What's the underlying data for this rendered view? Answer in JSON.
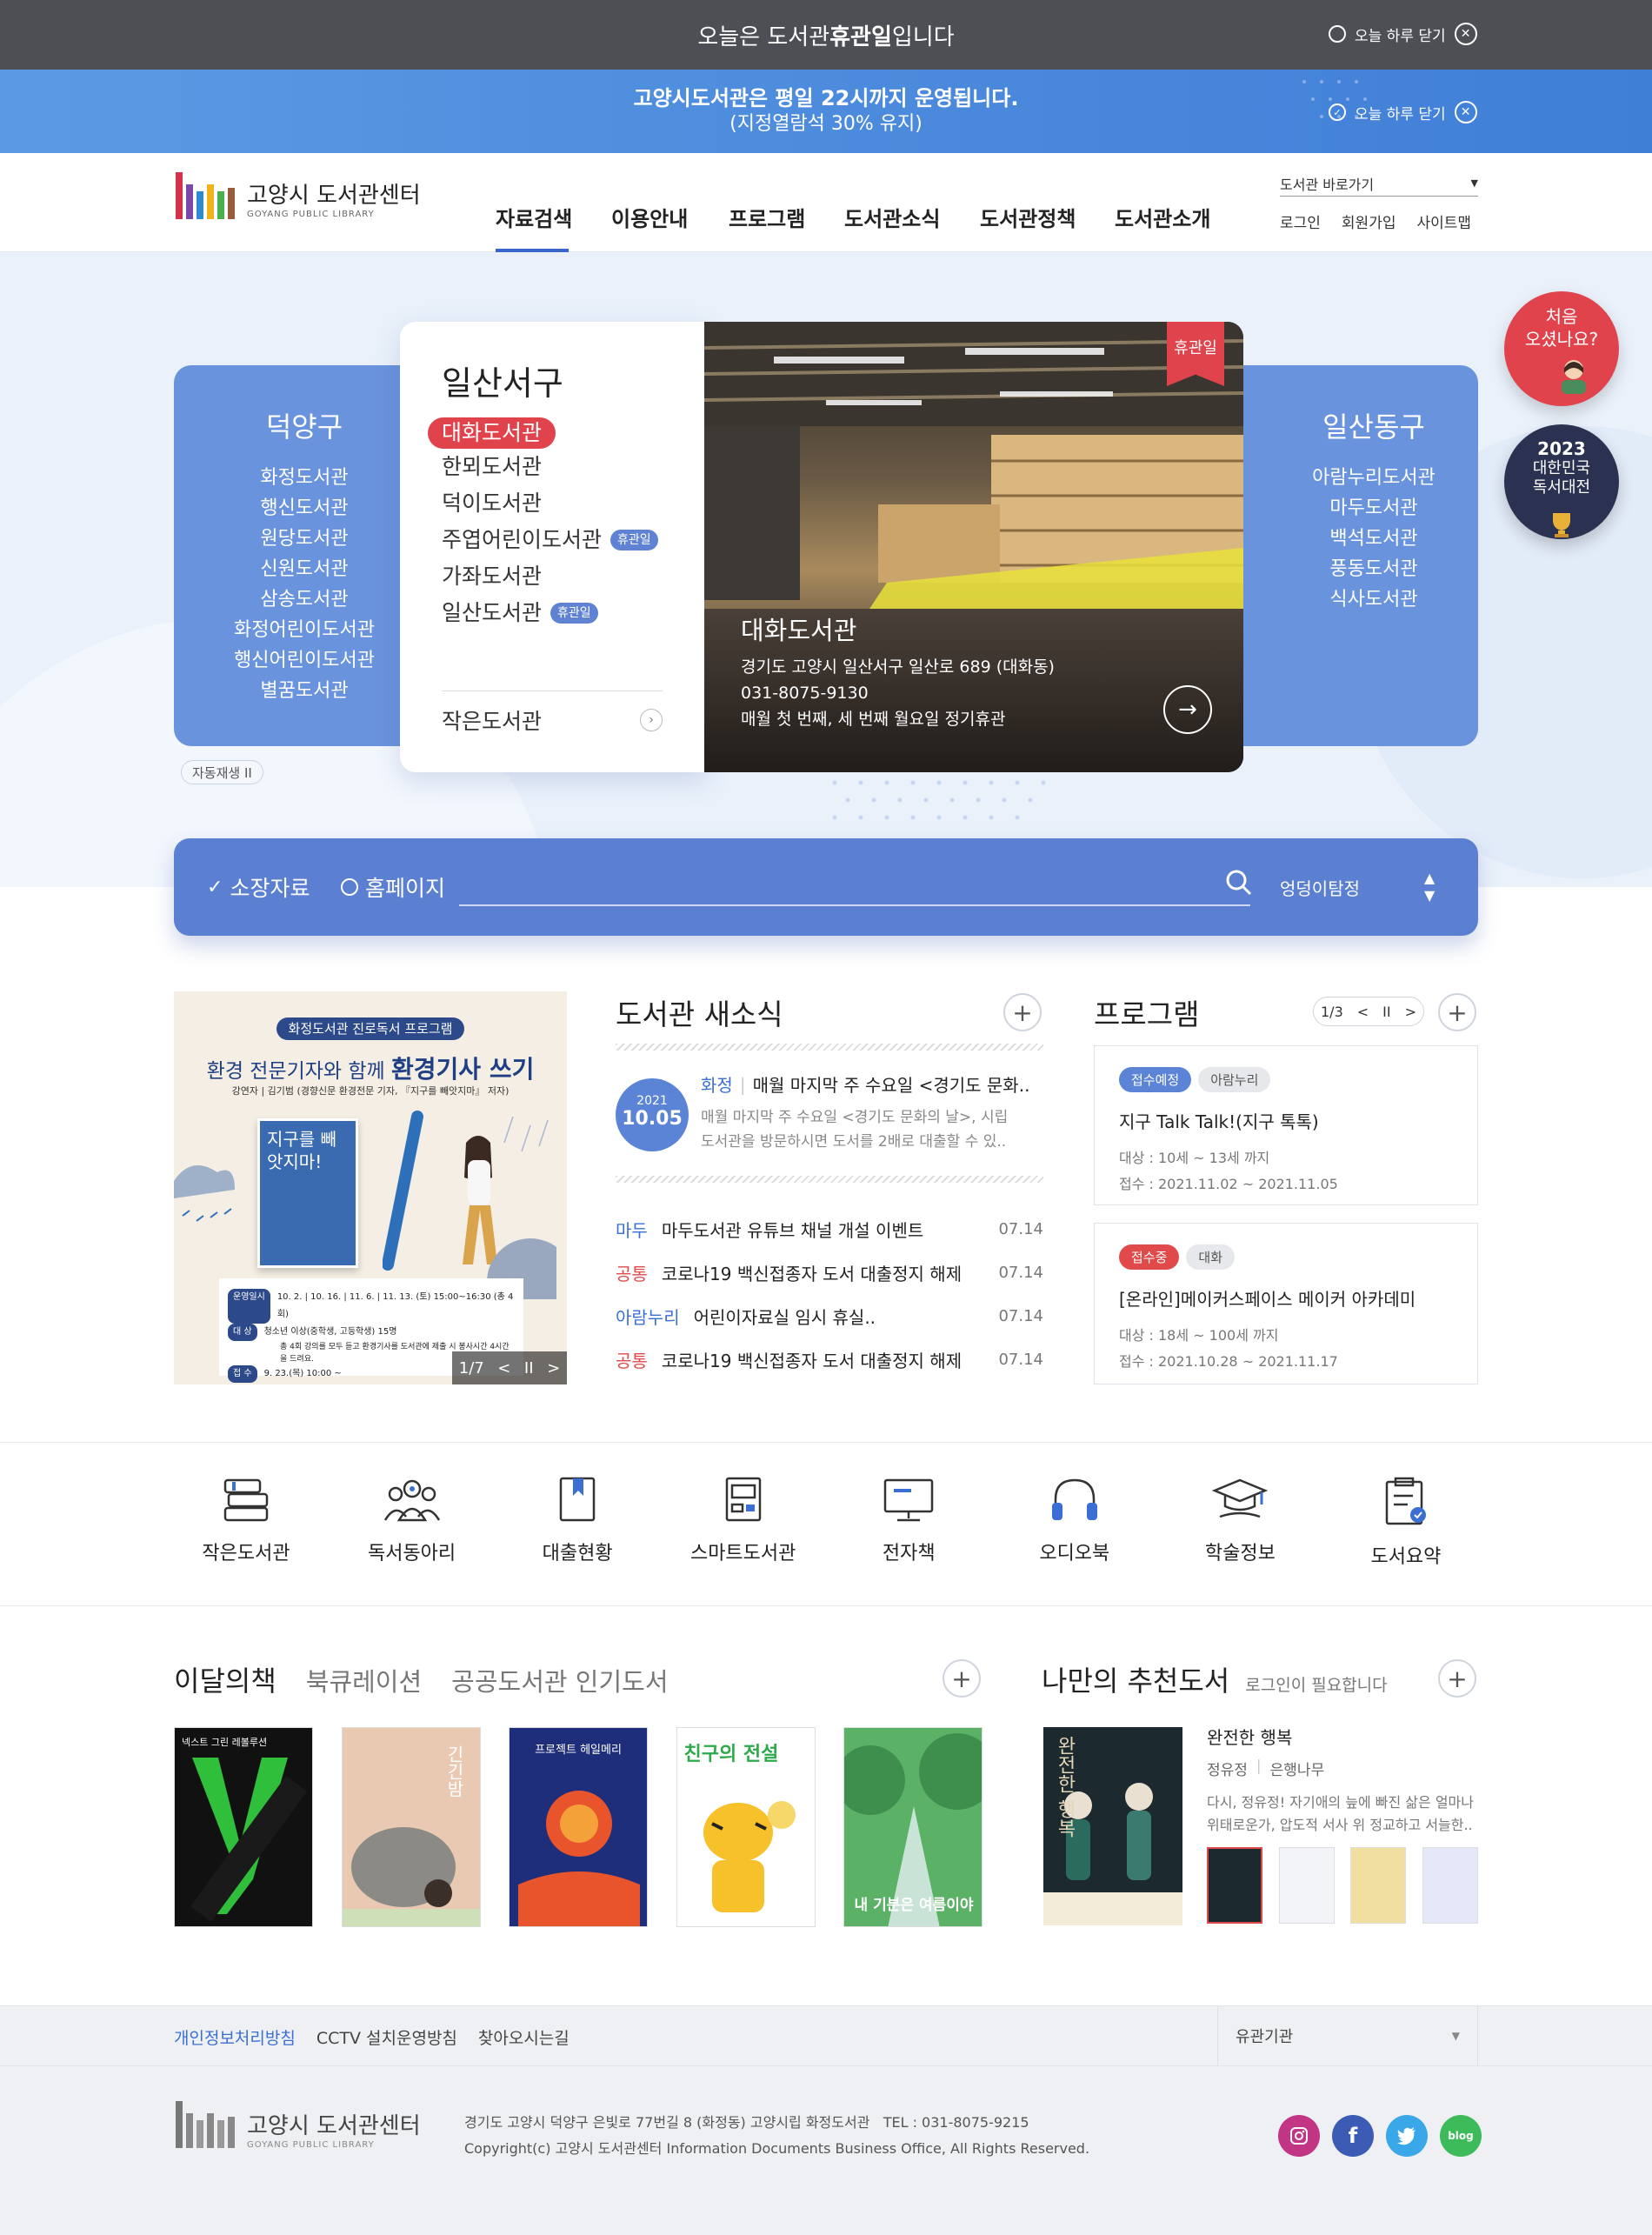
{
  "alert_bar": {
    "text_pre": "오늘은 도서관 ",
    "text_bold": "휴관일",
    "text_post": "입니다",
    "close_label": "오늘 하루 닫기"
  },
  "notice_bar": {
    "line1": "고양시도서관은 평일 22시까지 운영됩니다.",
    "line2": "(지정열람석 30% 유지)",
    "close_label": "오늘 하루 닫기"
  },
  "header": {
    "logo_title": "고양시 도서관센터",
    "logo_sub": "GOYANG PUBLIC LIBRARY",
    "nav": [
      "자료검색",
      "이용안내",
      "프로그램",
      "도서관소식",
      "도서관정책",
      "도서관소개"
    ],
    "shortcut_select": "도서관 바로가기",
    "util": [
      "로그인",
      "회원가입",
      "사이트맵"
    ]
  },
  "hero": {
    "left_district": {
      "name": "덕양구",
      "libraries": [
        "화정도서관",
        "행신도서관",
        "원당도서관",
        "신원도서관",
        "삼송도서관",
        "화정어린이도서관",
        "행신어린이도서관",
        "별꿈도서관"
      ]
    },
    "center_district": {
      "name": "일산서구",
      "libraries": [
        {
          "name": "대화도서관",
          "closed": ""
        },
        {
          "name": "한뫼도서관",
          "closed": ""
        },
        {
          "name": "덕이도서관",
          "closed": ""
        },
        {
          "name": "주엽어린이도서관",
          "closed": "휴관일"
        },
        {
          "name": "가좌도서관",
          "closed": ""
        },
        {
          "name": "일산도서관",
          "closed": "휴관일"
        }
      ],
      "small_library": "작은도서관"
    },
    "photo": {
      "ribbon": "휴관일",
      "name": "대화도서관",
      "address": "경기도 고양시 일산서구 일산로 689 (대화동)",
      "phone": "031-8075-9130",
      "closed_info": "매월 첫 번째, 세 번째 월요일 정기휴관"
    },
    "right_district": {
      "name": "일산동구",
      "libraries": [
        "아람누리도서관",
        "마두도서관",
        "백석도서관",
        "풍동도서관",
        "식사도서관"
      ]
    },
    "autoplay": "자동재생 II",
    "float1": {
      "line1": "처음",
      "line2": "오셨나요?"
    },
    "float2": {
      "line1": "2023",
      "line2": "대한민국",
      "line3": "독서대전"
    }
  },
  "search": {
    "opt1": "소장자료",
    "opt2": "홈페이지",
    "keyword": "엉덩이탐정"
  },
  "banner": {
    "tag": "화정도서관 진로독서 프로그램",
    "title_pre": "환경 전문기자와 함께 ",
    "title_bold": "환경기사 쓰기",
    "sub": "강연자 | 김기범 (경향신문 환경전문 기자, 『지구를 빼앗지마』 저자)",
    "book_title": "지구를 빼앗지마!",
    "rows": [
      {
        "k": "운영일시",
        "v": "10. 2. | 10. 16. | 11. 6. | 11. 13. (토) 15:00~16:30 (총 4회)"
      },
      {
        "k": "대  상",
        "v": "청소년 이상(중학생, 고등학생) 15명"
      },
      {
        "k": "",
        "v": "총 4회 강의를 모두 듣고 환경기사를 도서관에 제출 시 봉사시간 4시간을 드려요."
      },
      {
        "k": "접  수",
        "v": "9. 23.(목) 10:00 ~"
      }
    ],
    "pager": "1/7"
  },
  "news": {
    "title": "도서관 새소식",
    "featured": {
      "year": "2021",
      "date": "10.05",
      "tag": "화정",
      "title": "매월 마지막 주 수요일 <경기도 문화..",
      "desc1": "매월 마지막 주 수요일 <경기도 문화의 날>, 시립",
      "desc2": "도서관을 방문하시면 도서를 2배로 대출할 수 있.."
    },
    "items": [
      {
        "tag": "마두",
        "title": "마두도서관 유튜브 채널 개설 이벤트",
        "date": "07.14",
        "color": "#3b6fd4"
      },
      {
        "tag": "공통",
        "title": "코로나19 백신접종자 도서 대출정지 해제",
        "date": "07.14",
        "color": "#e04a4a"
      },
      {
        "tag": "아람누리",
        "title": "어린이자료실 임시 휴실..",
        "date": "07.14",
        "color": "#3b6fd4"
      },
      {
        "tag": "공통",
        "title": "코로나19 백신접종자 도서 대출정지 해제",
        "date": "07.14",
        "color": "#e04a4a"
      }
    ]
  },
  "programs": {
    "title": "프로그램",
    "pager": "1/3",
    "items": [
      {
        "status": "접수예정",
        "status_color": "#5b84d6",
        "lib": "아람누리",
        "title": "지구 Talk Talk!(지구 톡톡)",
        "target": "대상 : 10세 ~ 13세 까지",
        "period": "접수 : 2021.11.02 ~ 2021.11.05"
      },
      {
        "status": "접수중",
        "status_color": "#e04a4a",
        "lib": "대화",
        "title": "[온라인]메이커스페이스 메이커 아카데미",
        "target": "대상 : 18세 ~ 100세 까지",
        "period": "접수 : 2021.10.28 ~ 2021.11.17"
      }
    ]
  },
  "quick_menu": [
    "작은도서관",
    "독서동아리",
    "대출현황",
    "스마트도서관",
    "전자책",
    "오디오북",
    "학술정보",
    "도서요약"
  ],
  "books": {
    "tabs": [
      "이달의책",
      "북큐레이션",
      "공공도서관 인기도서"
    ],
    "covers": [
      {
        "title": "넥스트 그린 레볼루션",
        "bg": "#111111"
      },
      {
        "title": "긴긴밤",
        "bg": "#e9c9b1"
      },
      {
        "title": "프로젝트 헤일메리",
        "bg": "#1f2e7a"
      },
      {
        "title": "친구의 전설",
        "bg": "#ffffff"
      },
      {
        "title": "내 기분은 여름이야",
        "bg": "#6fbf74"
      }
    ]
  },
  "recommend": {
    "title": "나만의 추천도서",
    "note": "로그인이 필요합니다",
    "book_title": "완전한 행복",
    "author": "정유정",
    "publisher": "은행나무",
    "desc1": "다시, 정유정! 자기애의 늪에 빠진 삶은 얼마나",
    "desc2": "위태로운가, 압도적 서사 위 정교하고 서늘한..",
    "cover_text": "완전한 행복"
  },
  "footer": {
    "links": [
      "개인정보처리방침",
      "CCTV 설치운영방침",
      "찾아오시는길"
    ],
    "related": "유관기관",
    "logo_title": "고양시 도서관센터",
    "logo_sub": "GOYANG PUBLIC LIBRARY",
    "address": "경기도 고양시 덕양구 은빛로 77번길 8 (화정동) 고양시립 화정도서관   TEL : 031-8075-9215",
    "copyright": "Copyright(c) 고양시 도서관센터 Information Documents Business Office, All Rights Reserved.",
    "sns": [
      {
        "name": "instagram",
        "color": "#c13584"
      },
      {
        "name": "facebook",
        "color": "#3b5bb5"
      },
      {
        "name": "twitter",
        "color": "#3aa7e8"
      },
      {
        "name": "blog",
        "color": "#3dbb5b",
        "label": "blog"
      }
    ]
  }
}
